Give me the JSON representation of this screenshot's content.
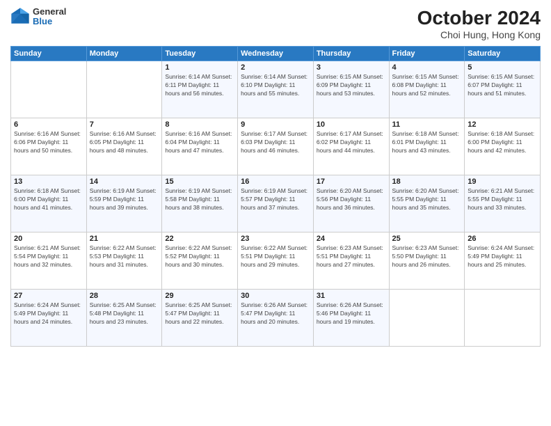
{
  "logo": {
    "general": "General",
    "blue": "Blue"
  },
  "header": {
    "title": "October 2024",
    "location": "Choi Hung, Hong Kong"
  },
  "days_of_week": [
    "Sunday",
    "Monday",
    "Tuesday",
    "Wednesday",
    "Thursday",
    "Friday",
    "Saturday"
  ],
  "weeks": [
    [
      {
        "day": "",
        "info": ""
      },
      {
        "day": "",
        "info": ""
      },
      {
        "day": "1",
        "info": "Sunrise: 6:14 AM\nSunset: 6:11 PM\nDaylight: 11 hours and 56 minutes."
      },
      {
        "day": "2",
        "info": "Sunrise: 6:14 AM\nSunset: 6:10 PM\nDaylight: 11 hours and 55 minutes."
      },
      {
        "day": "3",
        "info": "Sunrise: 6:15 AM\nSunset: 6:09 PM\nDaylight: 11 hours and 53 minutes."
      },
      {
        "day": "4",
        "info": "Sunrise: 6:15 AM\nSunset: 6:08 PM\nDaylight: 11 hours and 52 minutes."
      },
      {
        "day": "5",
        "info": "Sunrise: 6:15 AM\nSunset: 6:07 PM\nDaylight: 11 hours and 51 minutes."
      }
    ],
    [
      {
        "day": "6",
        "info": "Sunrise: 6:16 AM\nSunset: 6:06 PM\nDaylight: 11 hours and 50 minutes."
      },
      {
        "day": "7",
        "info": "Sunrise: 6:16 AM\nSunset: 6:05 PM\nDaylight: 11 hours and 48 minutes."
      },
      {
        "day": "8",
        "info": "Sunrise: 6:16 AM\nSunset: 6:04 PM\nDaylight: 11 hours and 47 minutes."
      },
      {
        "day": "9",
        "info": "Sunrise: 6:17 AM\nSunset: 6:03 PM\nDaylight: 11 hours and 46 minutes."
      },
      {
        "day": "10",
        "info": "Sunrise: 6:17 AM\nSunset: 6:02 PM\nDaylight: 11 hours and 44 minutes."
      },
      {
        "day": "11",
        "info": "Sunrise: 6:18 AM\nSunset: 6:01 PM\nDaylight: 11 hours and 43 minutes."
      },
      {
        "day": "12",
        "info": "Sunrise: 6:18 AM\nSunset: 6:00 PM\nDaylight: 11 hours and 42 minutes."
      }
    ],
    [
      {
        "day": "13",
        "info": "Sunrise: 6:18 AM\nSunset: 6:00 PM\nDaylight: 11 hours and 41 minutes."
      },
      {
        "day": "14",
        "info": "Sunrise: 6:19 AM\nSunset: 5:59 PM\nDaylight: 11 hours and 39 minutes."
      },
      {
        "day": "15",
        "info": "Sunrise: 6:19 AM\nSunset: 5:58 PM\nDaylight: 11 hours and 38 minutes."
      },
      {
        "day": "16",
        "info": "Sunrise: 6:19 AM\nSunset: 5:57 PM\nDaylight: 11 hours and 37 minutes."
      },
      {
        "day": "17",
        "info": "Sunrise: 6:20 AM\nSunset: 5:56 PM\nDaylight: 11 hours and 36 minutes."
      },
      {
        "day": "18",
        "info": "Sunrise: 6:20 AM\nSunset: 5:55 PM\nDaylight: 11 hours and 35 minutes."
      },
      {
        "day": "19",
        "info": "Sunrise: 6:21 AM\nSunset: 5:55 PM\nDaylight: 11 hours and 33 minutes."
      }
    ],
    [
      {
        "day": "20",
        "info": "Sunrise: 6:21 AM\nSunset: 5:54 PM\nDaylight: 11 hours and 32 minutes."
      },
      {
        "day": "21",
        "info": "Sunrise: 6:22 AM\nSunset: 5:53 PM\nDaylight: 11 hours and 31 minutes."
      },
      {
        "day": "22",
        "info": "Sunrise: 6:22 AM\nSunset: 5:52 PM\nDaylight: 11 hours and 30 minutes."
      },
      {
        "day": "23",
        "info": "Sunrise: 6:22 AM\nSunset: 5:51 PM\nDaylight: 11 hours and 29 minutes."
      },
      {
        "day": "24",
        "info": "Sunrise: 6:23 AM\nSunset: 5:51 PM\nDaylight: 11 hours and 27 minutes."
      },
      {
        "day": "25",
        "info": "Sunrise: 6:23 AM\nSunset: 5:50 PM\nDaylight: 11 hours and 26 minutes."
      },
      {
        "day": "26",
        "info": "Sunrise: 6:24 AM\nSunset: 5:49 PM\nDaylight: 11 hours and 25 minutes."
      }
    ],
    [
      {
        "day": "27",
        "info": "Sunrise: 6:24 AM\nSunset: 5:49 PM\nDaylight: 11 hours and 24 minutes."
      },
      {
        "day": "28",
        "info": "Sunrise: 6:25 AM\nSunset: 5:48 PM\nDaylight: 11 hours and 23 minutes."
      },
      {
        "day": "29",
        "info": "Sunrise: 6:25 AM\nSunset: 5:47 PM\nDaylight: 11 hours and 22 minutes."
      },
      {
        "day": "30",
        "info": "Sunrise: 6:26 AM\nSunset: 5:47 PM\nDaylight: 11 hours and 20 minutes."
      },
      {
        "day": "31",
        "info": "Sunrise: 6:26 AM\nSunset: 5:46 PM\nDaylight: 11 hours and 19 minutes."
      },
      {
        "day": "",
        "info": ""
      },
      {
        "day": "",
        "info": ""
      }
    ]
  ]
}
